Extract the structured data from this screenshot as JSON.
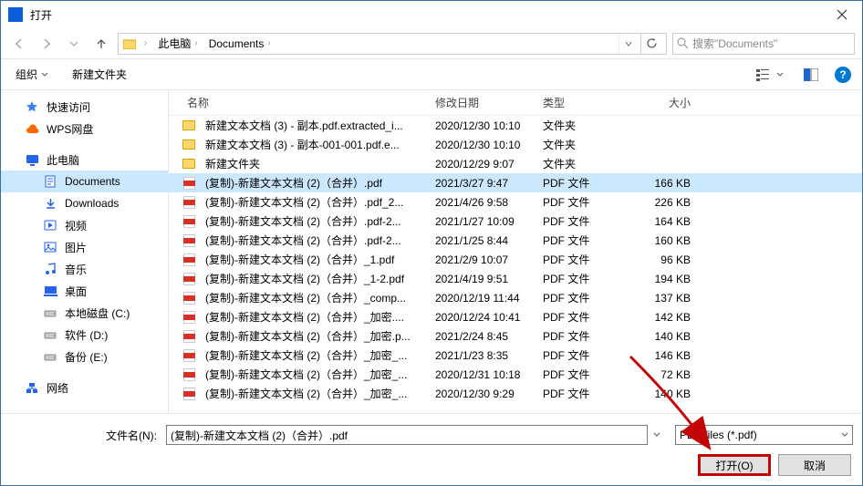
{
  "titlebar": {
    "title": "打开"
  },
  "nav": {
    "crumbs": [
      "此电脑",
      "Documents"
    ],
    "search_placeholder": "搜索\"Documents\""
  },
  "toolbar": {
    "organize": "组织",
    "newfolder": "新建文件夹"
  },
  "sidebar": {
    "items": [
      {
        "label": "快速访问",
        "icon": "star",
        "color": "#3b82f6"
      },
      {
        "label": "WPS网盘",
        "icon": "cloud",
        "color": "#ff6a00"
      },
      {
        "label": "此电脑",
        "icon": "monitor",
        "color": "#2563eb",
        "spacer_before": true
      },
      {
        "label": "Documents",
        "icon": "doc",
        "color": "#2563eb",
        "sub": true,
        "selected": true
      },
      {
        "label": "Downloads",
        "icon": "download",
        "color": "#2563eb",
        "sub": true
      },
      {
        "label": "视频",
        "icon": "video",
        "color": "#2563eb",
        "sub": true
      },
      {
        "label": "图片",
        "icon": "picture",
        "color": "#2563eb",
        "sub": true
      },
      {
        "label": "音乐",
        "icon": "music",
        "color": "#2563eb",
        "sub": true
      },
      {
        "label": "桌面",
        "icon": "desktop",
        "color": "#2563eb",
        "sub": true
      },
      {
        "label": "本地磁盘 (C:)",
        "icon": "disk",
        "color": "#888",
        "sub": true
      },
      {
        "label": "软件 (D:)",
        "icon": "disk",
        "color": "#888",
        "sub": true
      },
      {
        "label": "备份 (E:)",
        "icon": "disk",
        "color": "#888",
        "sub": true
      },
      {
        "label": "网络",
        "icon": "network",
        "color": "#2563eb",
        "spacer_before": true
      }
    ]
  },
  "list": {
    "headers": {
      "name": "名称",
      "date": "修改日期",
      "type": "类型",
      "size": "大小"
    },
    "rows": [
      {
        "icon": "folder",
        "name": "新建文本文档 (3) - 副本.pdf.extracted_i...",
        "date": "2020/12/30 10:10",
        "type": "文件夹",
        "size": ""
      },
      {
        "icon": "folder",
        "name": "新建文本文档 (3) - 副本-001-001.pdf.e...",
        "date": "2020/12/30 10:10",
        "type": "文件夹",
        "size": ""
      },
      {
        "icon": "folder",
        "name": "新建文件夹",
        "date": "2020/12/29 9:07",
        "type": "文件夹",
        "size": ""
      },
      {
        "icon": "pdf",
        "name": "(复制)-新建文本文档 (2)（合并）.pdf",
        "date": "2021/3/27 9:47",
        "type": "PDF 文件",
        "size": "166 KB",
        "selected": true
      },
      {
        "icon": "pdf",
        "name": "(复制)-新建文本文档 (2)（合并）.pdf_2...",
        "date": "2021/4/26 9:58",
        "type": "PDF 文件",
        "size": "226 KB"
      },
      {
        "icon": "pdf",
        "name": "(复制)-新建文本文档 (2)（合并）.pdf-2...",
        "date": "2021/1/27 10:09",
        "type": "PDF 文件",
        "size": "164 KB"
      },
      {
        "icon": "pdf",
        "name": "(复制)-新建文本文档 (2)（合并）.pdf-2...",
        "date": "2021/1/25 8:44",
        "type": "PDF 文件",
        "size": "160 KB"
      },
      {
        "icon": "pdf",
        "name": "(复制)-新建文本文档 (2)（合并）_1.pdf",
        "date": "2021/2/9 10:07",
        "type": "PDF 文件",
        "size": "96 KB"
      },
      {
        "icon": "pdf",
        "name": "(复制)-新建文本文档 (2)（合并）_1-2.pdf",
        "date": "2021/4/19 9:51",
        "type": "PDF 文件",
        "size": "194 KB"
      },
      {
        "icon": "pdf",
        "name": "(复制)-新建文本文档 (2)（合并）_comp...",
        "date": "2020/12/19 11:44",
        "type": "PDF 文件",
        "size": "137 KB"
      },
      {
        "icon": "pdf",
        "name": "(复制)-新建文本文档 (2)（合并）_加密....",
        "date": "2020/12/24 10:41",
        "type": "PDF 文件",
        "size": "142 KB"
      },
      {
        "icon": "pdf",
        "name": "(复制)-新建文本文档 (2)（合并）_加密.p...",
        "date": "2021/2/24 8:45",
        "type": "PDF 文件",
        "size": "140 KB"
      },
      {
        "icon": "pdf",
        "name": "(复制)-新建文本文档 (2)（合并）_加密_...",
        "date": "2021/1/23 8:35",
        "type": "PDF 文件",
        "size": "146 KB"
      },
      {
        "icon": "pdf",
        "name": "(复制)-新建文本文档 (2)（合并）_加密_...",
        "date": "2020/12/31 10:18",
        "type": "PDF 文件",
        "size": "72 KB"
      },
      {
        "icon": "pdf",
        "name": "(复制)-新建文本文档 (2)（合并）_加密_...",
        "date": "2020/12/30 9:29",
        "type": "PDF 文件",
        "size": "140 KB"
      }
    ]
  },
  "bottom": {
    "filename_label": "文件名(N):",
    "filename_value": "(复制)-新建文本文档 (2)（合并）.pdf",
    "filetype": "PDF files (*.pdf)",
    "open_btn": "打开(O)",
    "cancel_btn": "取消"
  }
}
